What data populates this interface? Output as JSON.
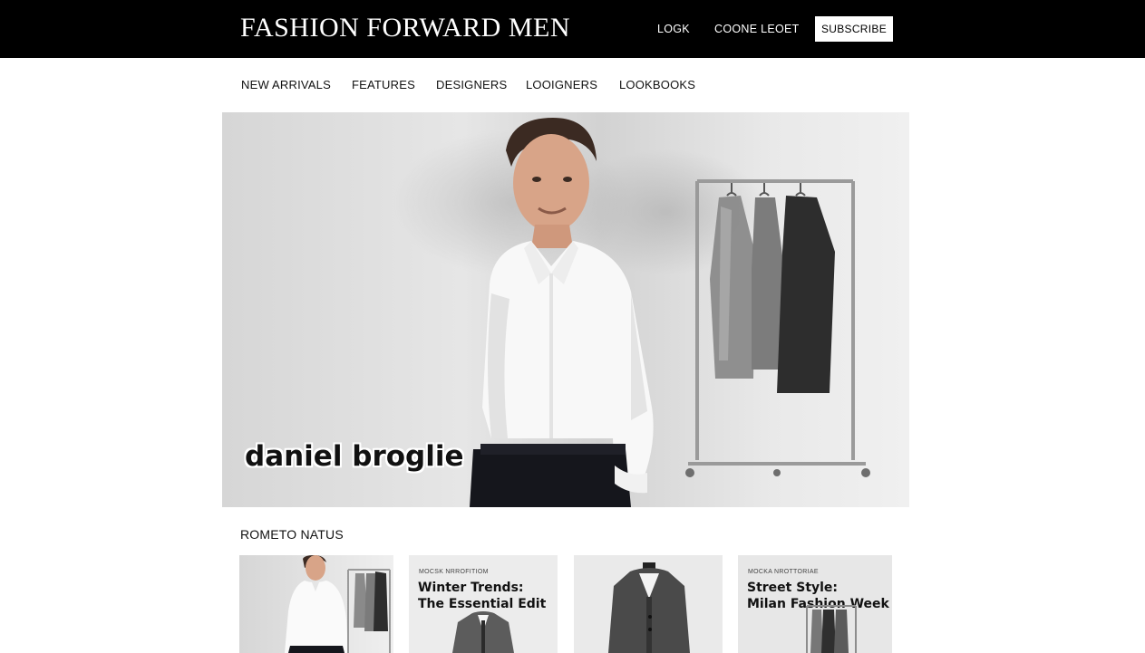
{
  "header": {
    "brand": "FASHION FORWARD MEN",
    "links": [
      "LOGK",
      "COONE LEOET"
    ],
    "subscribe_label": "SUBSCRIBE"
  },
  "nav": {
    "items": [
      "NEW ARRIVALS",
      "FEATURES",
      "DESIGNERS",
      "LOOIGNERS",
      "LOOKBOOKS"
    ]
  },
  "hero": {
    "caption": "daniel broglie"
  },
  "section": {
    "title": "ROMETO NATUS"
  },
  "cards": [
    {
      "kicker": "",
      "title": ""
    },
    {
      "kicker": "MOCSK NRROFITIOM",
      "title": "Winter Trends:\nThe Essential Edit"
    },
    {
      "kicker": "",
      "title": ""
    },
    {
      "kicker": "MOCKA NROTTORIAE",
      "title": "Street Style:\nMilan Fashion Week"
    }
  ],
  "colors": {
    "header_bg": "#000000",
    "page_bg": "#ffffff"
  },
  "icons": {
    "hero_person": "man-white-shirt-illustration",
    "hero_rack": "clothing-rack-illustration",
    "card_jacket": "jacket-illustration"
  }
}
